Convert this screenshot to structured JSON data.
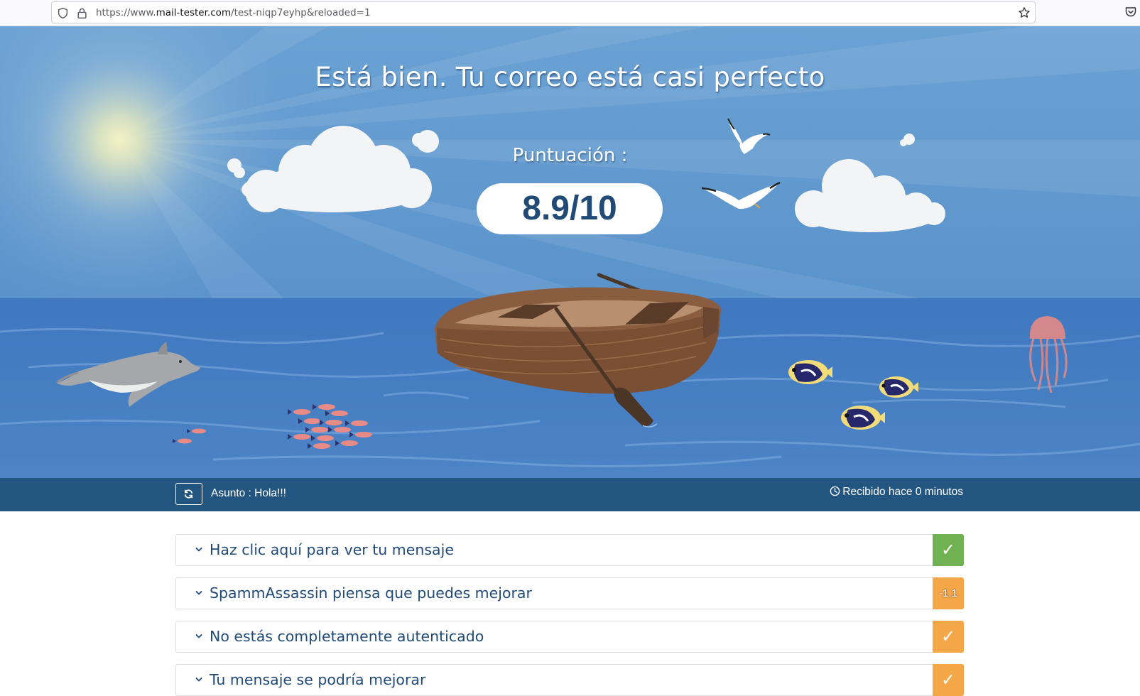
{
  "browser": {
    "url_prefix": "https://www.",
    "url_host": "mail-tester.com",
    "url_path": "/test-niqp7eyhp&reloaded=1"
  },
  "hero": {
    "title": "Está bien. Tu correo está casi perfecto",
    "score_label": "Puntuación :",
    "score": "8.9/10"
  },
  "subject_bar": {
    "subject": "Asunto : Hola!!!",
    "received": "Recibido hace 0 minutos"
  },
  "sections": [
    {
      "label": "Haz clic aquí para ver tu mensaje",
      "badge": "✓",
      "badge_color": "#70b152"
    },
    {
      "label": "SpammAssassin piensa que puedes mejorar",
      "badge": "-1.1",
      "badge_color": "#f5a647"
    },
    {
      "label": "No estás completamente autenticado",
      "badge": "✓",
      "badge_color": "#f5a647"
    },
    {
      "label": "Tu mensaje se podría mejorar",
      "badge": "✓",
      "badge_color": "#f5a647"
    }
  ],
  "colors": {
    "sky": "#6a9ed0",
    "sea": "#4a7fc2",
    "navy": "#214b76",
    "subject_bar": "#235581",
    "ok_green": "#70b152",
    "warn_orange": "#f5a647"
  }
}
